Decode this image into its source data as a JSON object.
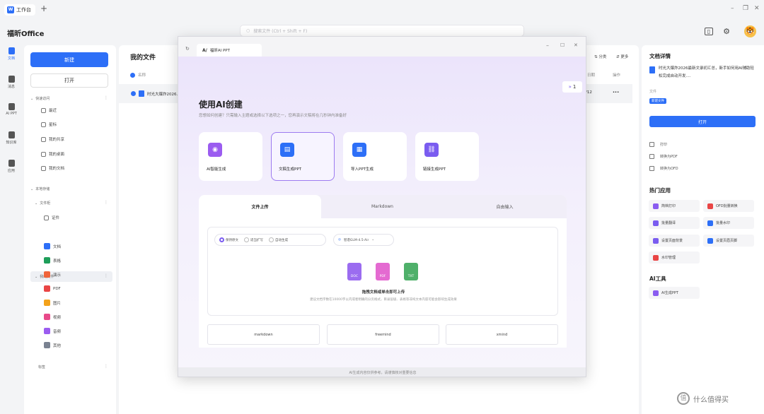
{
  "tabbar": {
    "tab_label": "工作台",
    "tab_logo": "W",
    "plus": "+"
  },
  "brand": "福昕Office",
  "search": {
    "placeholder": "搜索文件 (Ctrl + Shift + F)"
  },
  "rail": [
    {
      "label": "文档",
      "active": true
    },
    {
      "label": "消息"
    },
    {
      "label": "AI PPT"
    },
    {
      "label": "知识库"
    },
    {
      "label": "应用"
    }
  ],
  "sidebar": {
    "new_button": "新建",
    "open_button": "打开",
    "quick_access": "快速访问",
    "quick_items": [
      "最近",
      "星标",
      "我的共享",
      "我的桌面",
      "我的文档"
    ],
    "local": "本地存储",
    "folder": "文件柜",
    "recent_folder": "证件",
    "my_files": "我的文件",
    "types": [
      {
        "label": "文档",
        "color": "#2d6ff7"
      },
      {
        "label": "表格",
        "color": "#1e9e5a"
      },
      {
        "label": "演示",
        "color": "#f0643a"
      },
      {
        "label": "PDF",
        "color": "#e94545"
      },
      {
        "label": "图片",
        "color": "#f3a21b"
      },
      {
        "label": "视频",
        "color": "#e84a8a"
      },
      {
        "label": "音频",
        "color": "#9b5cf0"
      },
      {
        "label": "其他",
        "color": "#7a8291"
      }
    ],
    "tags": "标签"
  },
  "main": {
    "title": "我的文件",
    "col_name": "名称",
    "row_name": "时光大爆炸2026...",
    "col_date_fragment": "日期",
    "col_op_fragment": "操作",
    "row_date_fragment": "/12",
    "row_more": "···",
    "tool_sort": "分类",
    "tool_more": "更多"
  },
  "right_panel": {
    "title": "文档详情",
    "doc_title": "时光大爆炸2026最新文录初汇总，新手如何用AI辅助轻松完成自动开发....",
    "doc_type": "文件",
    "doc_tag": "新建文件",
    "open_button": "打开",
    "actions": [
      "打印",
      "转换为PDF",
      "转换为OFD"
    ],
    "hot_title": "热门应用",
    "hot_apps": [
      {
        "label": "简档打印",
        "color": "#8a5cf0"
      },
      {
        "label": "OFD批量转换",
        "color": "#e94545"
      },
      {
        "label": "批量翻译",
        "color": "#7a5cf0"
      },
      {
        "label": "批量水印",
        "color": "#2d6ff7"
      },
      {
        "label": "设置页面背景",
        "color": "#7a5cf0"
      },
      {
        "label": "设置页眉页脚",
        "color": "#2d6ff7"
      },
      {
        "label": "水印管理",
        "color": "#e94545"
      }
    ],
    "ai_title": "AI工具",
    "ai_tool": "AI生成PPT"
  },
  "modal": {
    "tab": "福昕AI PPT",
    "tab_logo": "A/",
    "heading": "使用AI创建",
    "subtitle": "您想如何创建？只需输入主题或选择以下选项之一，您再演示文稿将在几秒钟内准备好",
    "badge_count": "1",
    "cards": [
      {
        "label": "AI智能生成",
        "color": "#9b5cf0"
      },
      {
        "label": "文稿生成PPT",
        "color": "#2d6ff7"
      },
      {
        "label": "导入PPT生成",
        "color": "#2d6ff7"
      },
      {
        "label": "链接生成PPT",
        "color": "#7a5cf0"
      }
    ],
    "panel_tabs": [
      "文件上传",
      "Markdown",
      "自由输入"
    ],
    "options": [
      "保持原文",
      "适当扩写",
      "自动生成"
    ],
    "model": "智谱GLM-4.5-Air",
    "file_icons": [
      {
        "label": "DOC",
        "color": "#9b6cf0"
      },
      {
        "label": "PDF",
        "color": "#e46ad1"
      },
      {
        "label": "TXT",
        "color": "#4fb06a"
      }
    ],
    "upload_title": "拖拽文档或单击即可上传",
    "upload_hint": "建议文档字数在10000字以内或者明确的分页格式，目录层级、表格等非纯文本内容可能会影响生成效果",
    "formats": [
      "markdown",
      "freemind",
      "xmind"
    ],
    "footer": "AI生成内容仅供参考，请谨慎核对重要信息"
  },
  "watermark": "什么值得买"
}
